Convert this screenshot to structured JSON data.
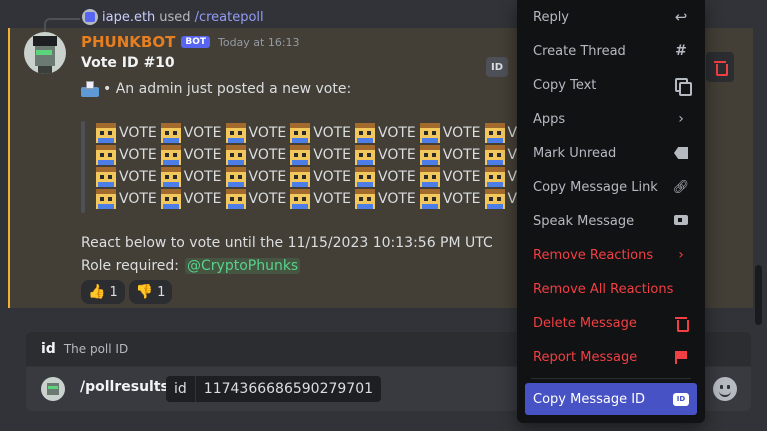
{
  "reply": {
    "user": "iape.eth",
    "used_text": "used",
    "command": "/createpoll"
  },
  "message": {
    "author": "PHUNKBOT",
    "badge": "BOT",
    "timestamp": "Today at 16:13",
    "title": "Vote ID #10",
    "intro": "• An admin just posted a new vote:",
    "vote_word": "VOTE",
    "vote_lines": [
      [
        "VOTE",
        "VOTE",
        "VOTE",
        "VOTE",
        "VOTE",
        "VOTE",
        "VOTE"
      ],
      [
        "VOTE",
        "VOTE",
        "VOTE",
        "VOTE",
        "VOTE",
        "VOTE",
        "VOTE"
      ],
      [
        "VOTE",
        "VOTE",
        "VOTE",
        "VOTE",
        "VOTE",
        "VOTE",
        "VOTE"
      ],
      [
        "VOTE",
        "VOTE",
        "VOTE",
        "VOTE",
        "VOTE",
        "VOTE",
        "VOTE"
      ]
    ],
    "react_text": "React below to vote until the 11/15/2023 10:13:56 PM UTC",
    "role_label": "Role required:",
    "role_mention": "@CryptoPhunks",
    "reactions": [
      {
        "emoji": "thumbs-up",
        "count": "1"
      },
      {
        "emoji": "thumbs-down",
        "count": "1"
      }
    ],
    "id_badge": "ID"
  },
  "slash": {
    "option_name": "id",
    "option_desc": "The poll ID",
    "command": "/pollresults",
    "param_name": "id",
    "param_value": "1174366686590279701"
  },
  "menu": {
    "items": [
      {
        "label": "Reply",
        "icon": "reply-icon",
        "type": "normal"
      },
      {
        "label": "Create Thread",
        "icon": "thread-icon",
        "type": "normal"
      },
      {
        "label": "Copy Text",
        "icon": "copy-icon",
        "type": "normal"
      },
      {
        "label": "Apps",
        "icon": "chevron-right-icon",
        "type": "normal"
      },
      {
        "label": "Mark Unread",
        "icon": "mark-unread-icon",
        "type": "normal"
      },
      {
        "label": "Copy Message Link",
        "icon": "link-icon",
        "type": "normal"
      },
      {
        "label": "Speak Message",
        "icon": "speaker-icon",
        "type": "normal"
      },
      {
        "label": "Remove Reactions",
        "icon": "chevron-right-icon",
        "type": "danger"
      },
      {
        "label": "Remove All Reactions",
        "icon": "",
        "type": "danger"
      },
      {
        "label": "Delete Message",
        "icon": "trash-icon",
        "type": "danger"
      },
      {
        "label": "Report Message",
        "icon": "flag-icon",
        "type": "danger"
      },
      {
        "label": "Copy Message ID",
        "icon": "id-icon",
        "type": "selected"
      }
    ],
    "id_icon_text": "ID"
  },
  "colors": {
    "bot_name": "#e67e22",
    "accent": "#5865f2",
    "danger": "#f23f43",
    "mention": "#58d38b",
    "highlight_border": "#f0b232"
  }
}
